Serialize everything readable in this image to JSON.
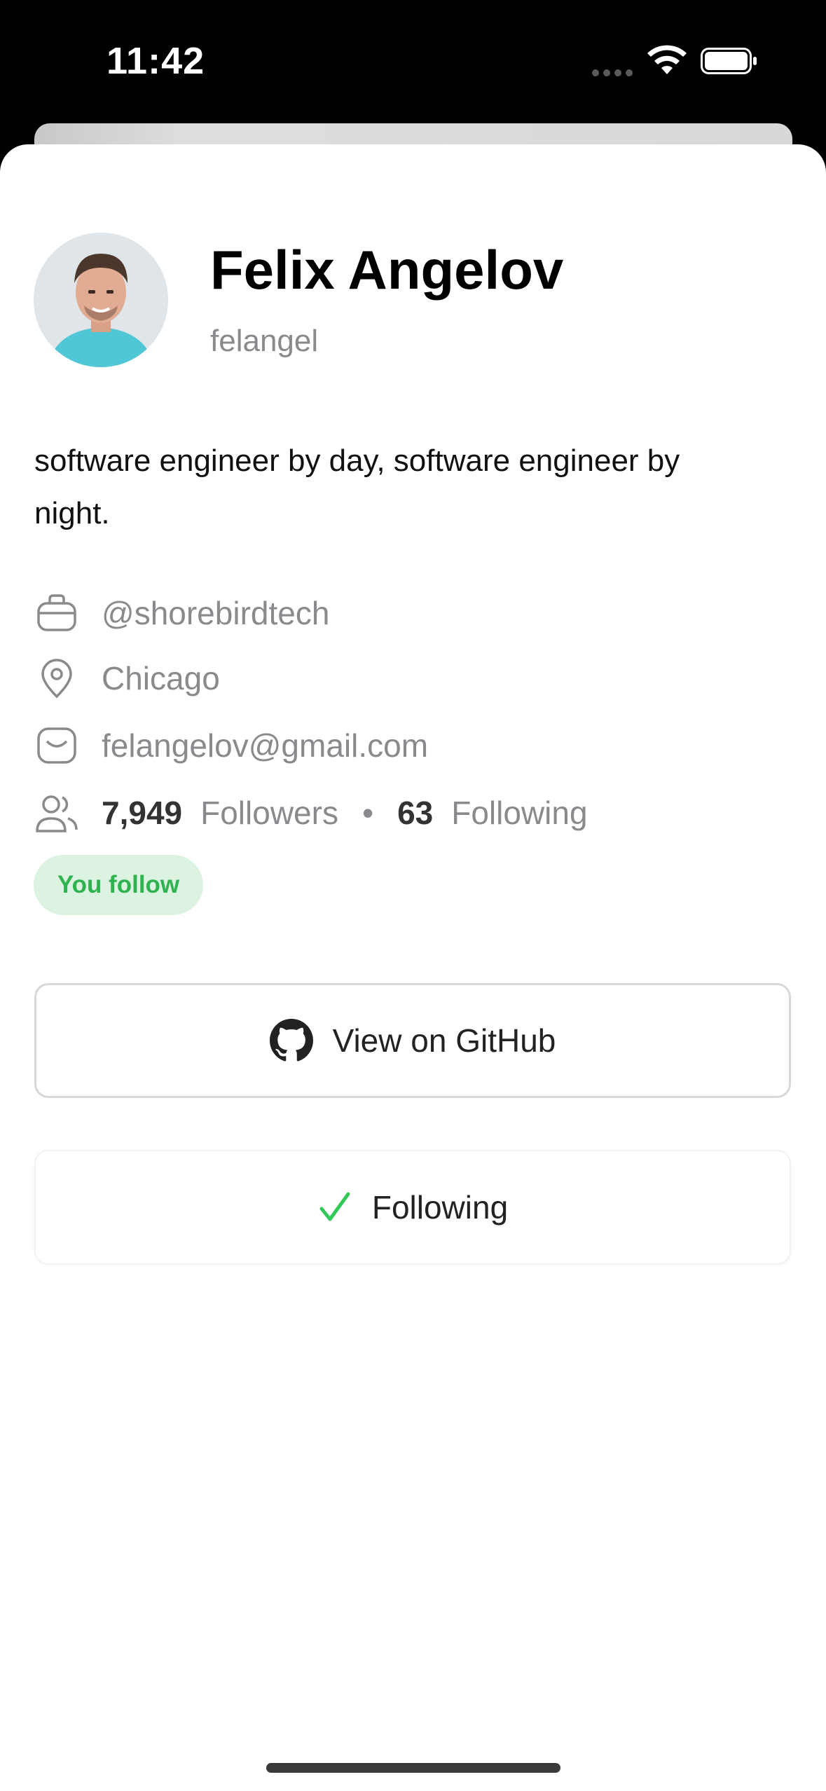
{
  "status_bar": {
    "time": "11:42"
  },
  "profile": {
    "name": "Felix Angelov",
    "username": "felangel",
    "bio": "software engineer by day, software engineer by night.",
    "company": "@shorebirdtech",
    "location": "Chicago",
    "email": "felangelov@gmail.com",
    "followers_count": "7,949",
    "followers_label": "Followers",
    "separator": "•",
    "following_count": "63",
    "following_label": "Following",
    "badge": "You follow"
  },
  "actions": {
    "github_label": "View on GitHub",
    "following_label": "Following"
  },
  "colors": {
    "accent_green": "#34C759",
    "badge_bg": "#DCF3E2",
    "secondary_text": "#8A8A8E"
  },
  "icons": [
    "briefcase-icon",
    "location-pin-icon",
    "mail-icon",
    "people-icon",
    "github-icon",
    "checkmark-icon"
  ]
}
